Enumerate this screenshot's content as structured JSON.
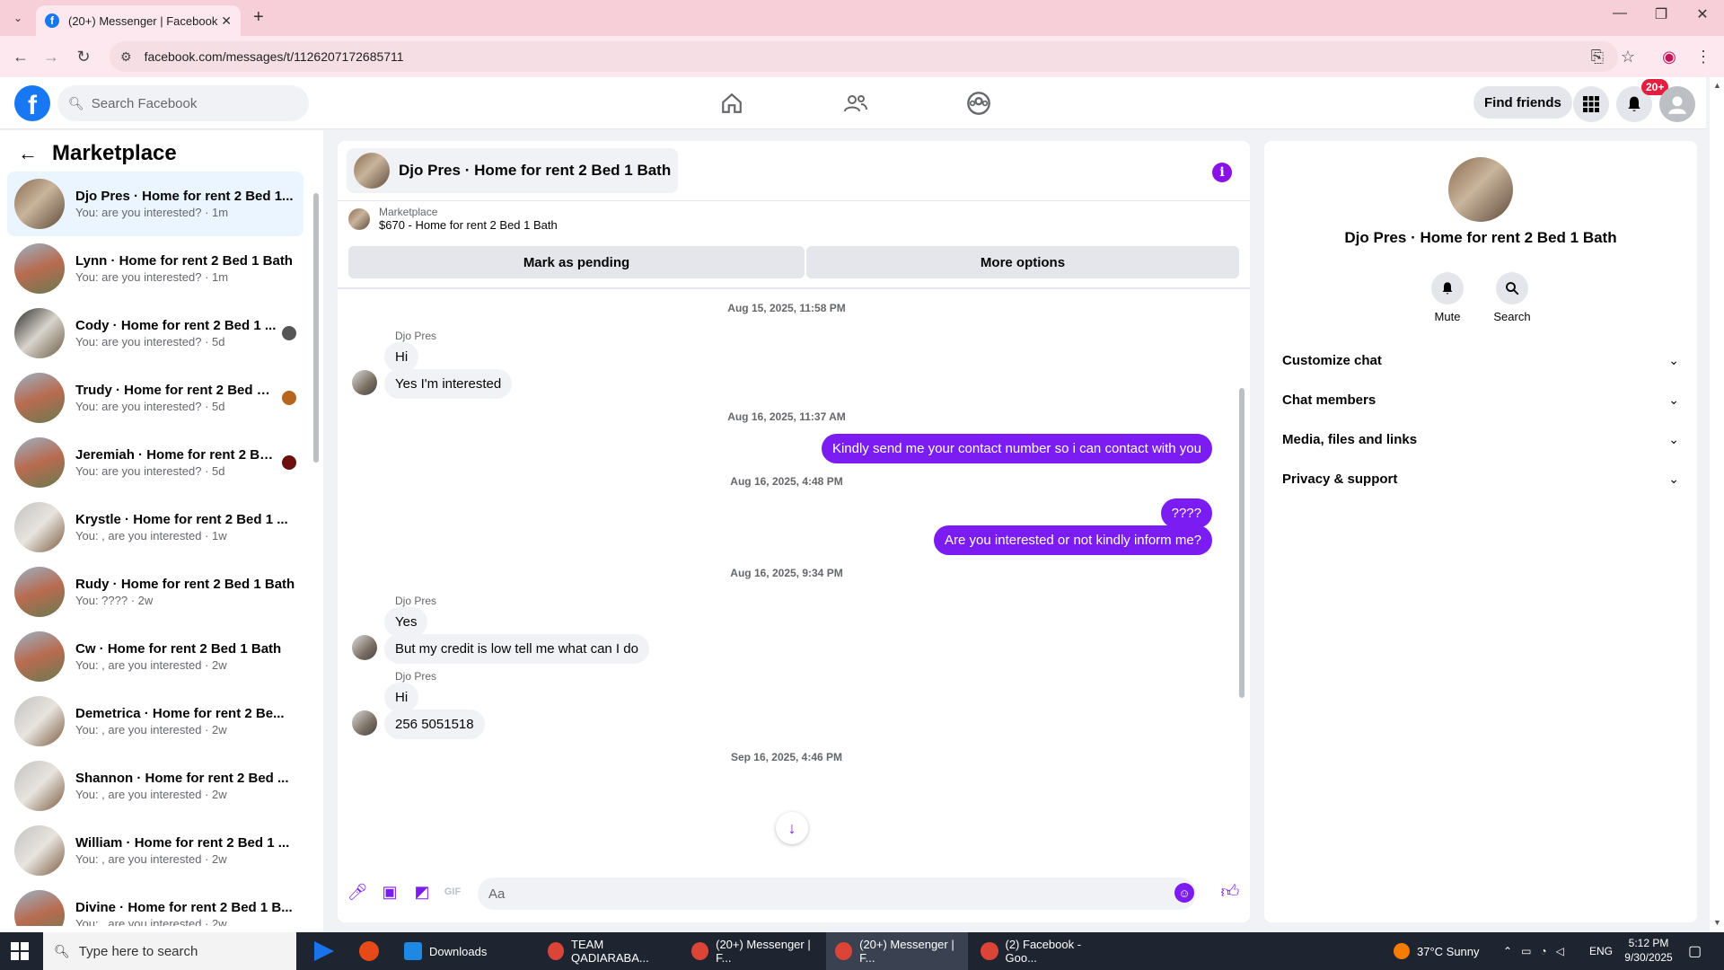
{
  "browser": {
    "tab_title": "(20+) Messenger | Facebook",
    "url": "facebook.com/messages/t/1126207172685711"
  },
  "fb": {
    "search_placeholder": "Search Facebook",
    "find_friends": "Find friends",
    "notif_badge": "20+"
  },
  "left": {
    "title": "Marketplace",
    "conversations": [
      {
        "name": "Djo Pres · Home for rent 2 Bed 1...",
        "preview": "You: are you interested? · 1m"
      },
      {
        "name": "Lynn · Home for rent 2 Bed 1 Bath",
        "preview": "You: are you interested? · 1m"
      },
      {
        "name": "Cody · Home for rent 2 Bed 1 ...",
        "preview": "You: are you interested? · 5d"
      },
      {
        "name": "Trudy · Home for rent 2 Bed 1 ...",
        "preview": "You: are you interested? · 5d"
      },
      {
        "name": "Jeremiah · Home for rent 2 Be...",
        "preview": "You: are you interested? · 5d"
      },
      {
        "name": "Krystle · Home for rent 2 Bed 1 ...",
        "preview": "You: , are you interested · 1w"
      },
      {
        "name": "Rudy · Home for rent 2 Bed 1 Bath",
        "preview": "You: ???? · 2w"
      },
      {
        "name": "Cw · Home for rent 2 Bed 1 Bath",
        "preview": "You: , are you interested · 2w"
      },
      {
        "name": "Demetrica · Home for rent 2 Be...",
        "preview": "You: , are you interested · 2w"
      },
      {
        "name": "Shannon · Home for rent 2 Bed ...",
        "preview": "You: , are you interested · 2w"
      },
      {
        "name": "William · Home for rent 2 Bed 1 ...",
        "preview": "You: , are you interested · 2w"
      },
      {
        "name": "Divine · Home for rent 2 Bed 1 B...",
        "preview": "You: , are you interested · 2w"
      }
    ]
  },
  "chat": {
    "title": "Djo Pres · Home for rent 2 Bed 1 Bath",
    "marketplace_label": "Marketplace",
    "listing": "$670 - Home for rent 2 Bed 1 Bath",
    "mark_pending": "Mark as pending",
    "more_options": "More options",
    "ts1": "Aug 15, 2025, 11:58 PM",
    "sender1": "Djo Pres",
    "m1": "Hi",
    "m2": "Yes I'm interested",
    "ts2": "Aug 16, 2025, 11:37 AM",
    "m3": "Kindly send me your contact number so i can contact with you",
    "ts3": "Aug 16, 2025, 4:48 PM",
    "m4": "????",
    "m5": "Are you interested or not kindly inform me?",
    "ts4": "Aug 16, 2025, 9:34 PM",
    "sender2": "Djo Pres",
    "m6": "Yes",
    "m7": "But my credit is low tell me what can I do",
    "sender3": "Djo Pres",
    "m8": "Hi",
    "m9": "256 5051518",
    "ts5": "Sep 16, 2025, 4:46 PM",
    "composer_placeholder": "Aa"
  },
  "right": {
    "name": "Djo Pres · Home for rent 2 Bed 1 Bath",
    "mute": "Mute",
    "search": "Search",
    "items": [
      "Customize chat",
      "Chat members",
      "Media, files and links",
      "Privacy & support"
    ]
  },
  "taskbar": {
    "search_placeholder": "Type here to search",
    "apps": [
      "Downloads",
      "TEAM QADIARABA...",
      "(20+) Messenger | F...",
      "(20+) Messenger | F...",
      "(2) Facebook - Goo..."
    ],
    "weather": "37°C  Sunny",
    "lang": "ENG",
    "time": "5:12 PM",
    "date": "9/30/2025"
  },
  "colors": {
    "accent": "#7a1cf2",
    "fb_blue": "#1877f2"
  }
}
